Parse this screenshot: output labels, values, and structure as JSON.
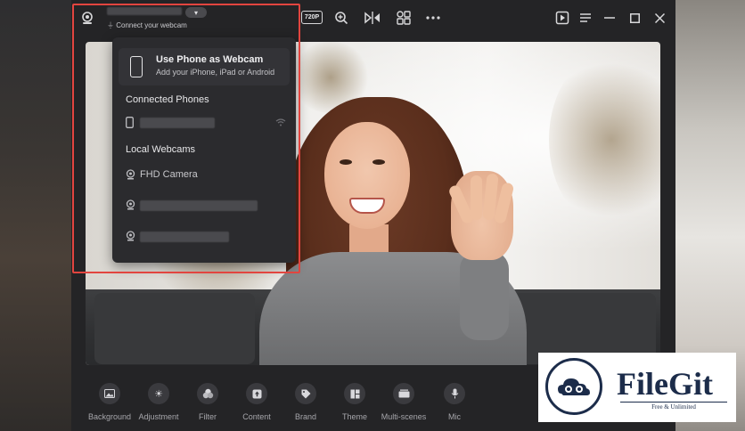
{
  "header": {
    "subtitle": "Connect your webcam",
    "resolution_badge": "720P"
  },
  "dropdown": {
    "phone_card": {
      "title": "Use Phone as Webcam",
      "subtitle": "Add your iPhone, iPad or Android"
    },
    "connected_phones_heading": "Connected Phones",
    "local_webcams_heading": "Local Webcams",
    "webcams": [
      {
        "label": "FHD Camera"
      }
    ]
  },
  "toolbar": {
    "items": [
      {
        "label": "Background",
        "icon": "image-icon"
      },
      {
        "label": "Adjustment",
        "icon": "sun-icon"
      },
      {
        "label": "Filter",
        "icon": "filter-circles-icon"
      },
      {
        "label": "Content",
        "icon": "upload-box-icon"
      },
      {
        "label": "Brand",
        "icon": "tag-icon"
      },
      {
        "label": "Theme",
        "icon": "layout-icon"
      },
      {
        "label": "Multi-scenes",
        "icon": "layers-icon"
      },
      {
        "label": "Mic",
        "icon": "microphone-icon"
      }
    ]
  },
  "watermark": {
    "name": "FileGit",
    "tagline": "Free & Unlimited"
  },
  "colors": {
    "highlight": "#e2453f",
    "window_bg": "#242426",
    "panel_bg": "#2b2b2e",
    "watermark_navy": "#1c2c4a"
  }
}
